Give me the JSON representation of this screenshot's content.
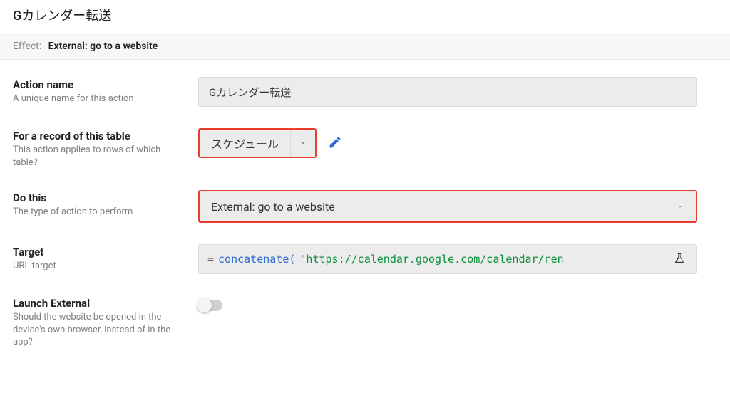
{
  "header": {
    "title": "Gカレンダー転送"
  },
  "subheader": {
    "effect_label": "Effect:",
    "effect_value": "External: go to a website"
  },
  "fields": {
    "action_name": {
      "label": "Action name",
      "desc": "A unique name for this action",
      "value": "Gカレンダー転送"
    },
    "table": {
      "label": "For a record of this table",
      "desc": "This action applies to rows of which table?",
      "value": "スケジュール"
    },
    "do_this": {
      "label": "Do this",
      "desc": "The type of action to perform",
      "value": "External: go to a website"
    },
    "target": {
      "label": "Target",
      "desc": "URL target",
      "expr_eq": "=",
      "expr_func": "concatenate(",
      "expr_str": "\"https://calendar.google.com/calendar/ren"
    },
    "launch_external": {
      "label": "Launch External",
      "desc": "Should the website be opened in the device's own browser, instead of in the app?",
      "value": false
    }
  }
}
